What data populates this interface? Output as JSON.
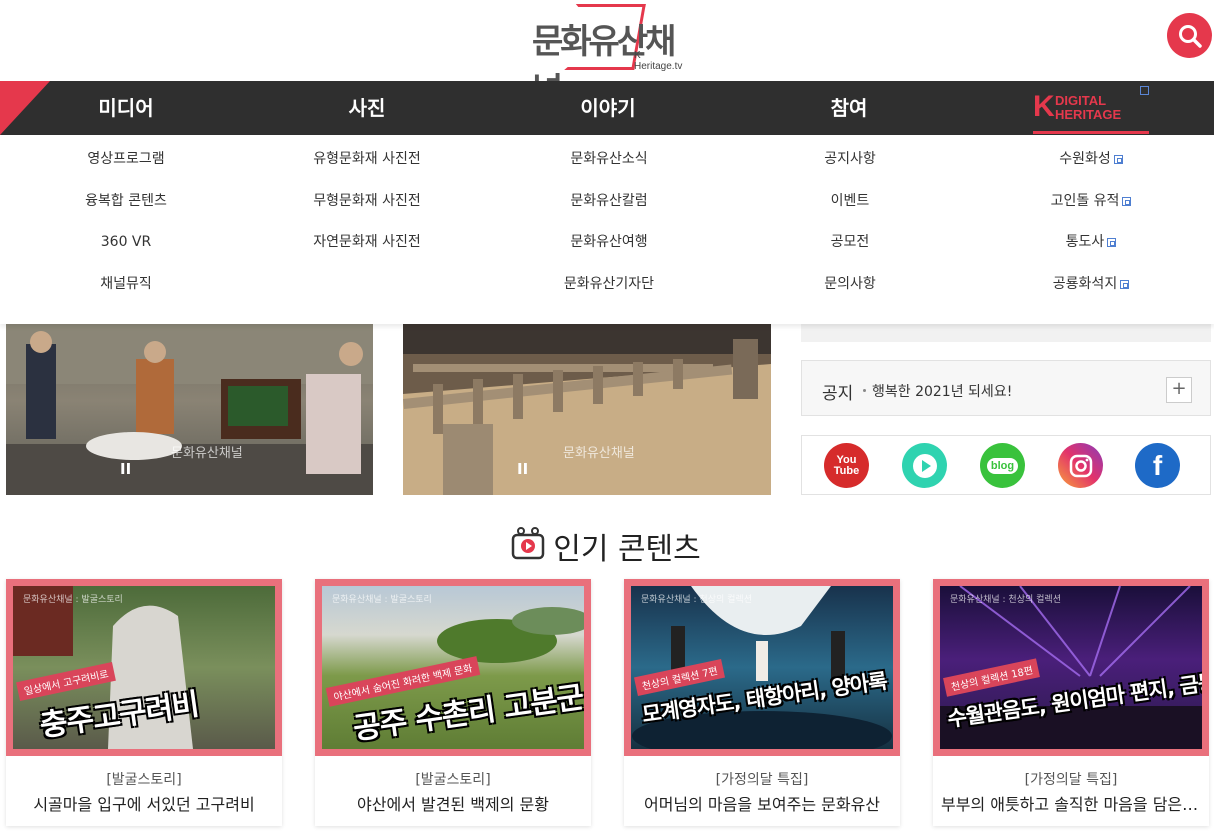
{
  "header": {
    "logo_text": "문화유산채널",
    "logo_sub": "K-Heritage.tv"
  },
  "nav": {
    "items": [
      "미디어",
      "사진",
      "이야기",
      "참여"
    ],
    "digital_heritage": {
      "k": "K",
      "line1": "DIGITAL",
      "line2": "HERITAGE"
    }
  },
  "dropdown": {
    "media": [
      "영상프로그램",
      "융복합 콘텐츠",
      "360 VR",
      "채널뮤직"
    ],
    "photo": [
      "유형문화재 사진전",
      "무형문화재 사진전",
      "자연문화재 사진전"
    ],
    "story": [
      "문화유산소식",
      "문화유산칼럼",
      "문화유산여행",
      "문화유산기자단"
    ],
    "participate": [
      "공지사항",
      "이벤트",
      "공모전",
      "문의사항"
    ],
    "digital": [
      "수원화성",
      "고인돌 유적",
      "통도사",
      "공룡화석지"
    ]
  },
  "videos": {
    "pause_glyph": "II",
    "watermark": "문화유산채널"
  },
  "notice": {
    "title": "공지",
    "text": "행복한 2021년 되세요!",
    "plus": "+"
  },
  "social": {
    "youtube": "You Tube",
    "blog": "blog",
    "facebook": "f"
  },
  "popular": {
    "title": "인기 콘텐츠",
    "cards": [
      {
        "category": "[발굴스토리]",
        "title": "시골마을 입구에 서있던 고구려비",
        "ribbon": "일상에서 고구려비로",
        "headline": "충주고구려비",
        "channel": "문화유산채널 : 발굴스토리"
      },
      {
        "category": "[발굴스토리]",
        "title": "야산에서 발견된 백제의 문황",
        "ribbon": "야산에서 숨어진 화려한 백제 문화",
        "headline": "공주 수촌리 고분군",
        "channel": "문화유산채널 : 발굴스토리"
      },
      {
        "category": "[가정의달 특집]",
        "title": "어머님의 마음을 보여주는 문화유산",
        "ribbon": "천상의 컬렉션 7편",
        "headline": "모계영자도, 태항아리, 양아록",
        "channel": "문화유산채널 : 천상의 컬렉션"
      },
      {
        "category": "[가정의달 특집]",
        "title": "부부의 애틋하고 솔직한 마음을 담은 …",
        "ribbon": "천상의 컬렉션 18편",
        "headline": "수월관음도, 원이엄마 편지, 금동신발",
        "channel": "문화유산채널 : 천상의 컬렉션"
      }
    ]
  },
  "colors": {
    "accent": "#e5384c",
    "nav_bg": "#2f2f2f",
    "card_frame": "#e9707c"
  }
}
